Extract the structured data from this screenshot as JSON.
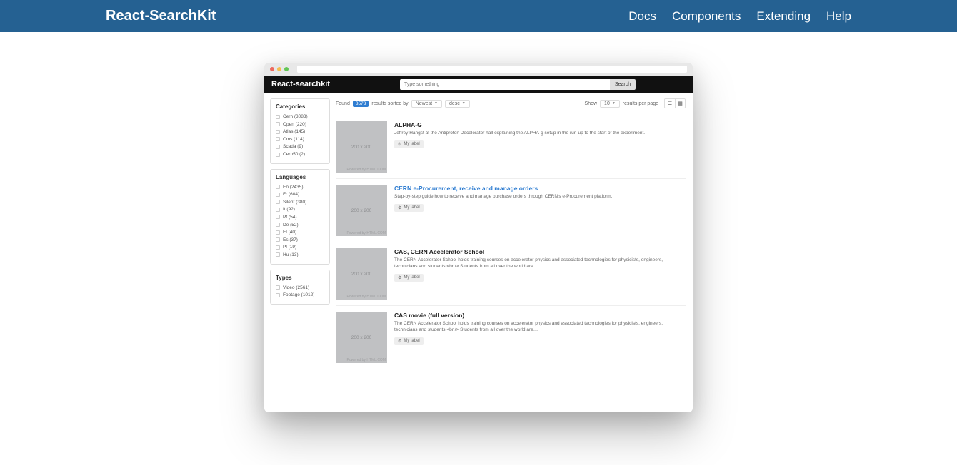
{
  "topbar": {
    "brand": "React-SearchKit",
    "nav": [
      "Docs",
      "Components",
      "Extending",
      "Help"
    ]
  },
  "app": {
    "title": "React-searchkit",
    "search_placeholder": "Type something",
    "search_button": "Search"
  },
  "controls": {
    "found_label": "Found",
    "count": "3573",
    "sorted_label": "results sorted by",
    "sort_field": "Newest",
    "sort_dir": "desc",
    "show_label": "Show",
    "page_size": "10",
    "per_page_label": "results per page"
  },
  "facets": [
    {
      "title": "Categories",
      "items": [
        "Cern (3083)",
        "Open (220)",
        "Atlas (145)",
        "Cms (114)",
        "Scada (9)",
        "Cern50 (2)"
      ]
    },
    {
      "title": "Languages",
      "items": [
        "En (2435)",
        "Fr (604)",
        "Silent (380)",
        "It (92)",
        "Pt (54)",
        "De (52)",
        "El (40)",
        "Es (37)",
        "Pl (19)",
        "Hu (13)"
      ]
    },
    {
      "title": "Types",
      "items": [
        "Video (2561)",
        "Footage (1012)"
      ]
    }
  ],
  "thumb_text": "200 x 200",
  "thumb_wm": "Powered by HTML.COM",
  "label_text": "My label",
  "results": [
    {
      "title": "ALPHA-G",
      "link": false,
      "desc": "Jeffrey Hangst at the Antiproton Decelerator hall explaining the ALPHA-g setup in the run-up to the start of the experiment."
    },
    {
      "title": "CERN e-Procurement, receive and manage orders",
      "link": true,
      "desc": "Step-by-step guide how to receive and manage purchase orders through CERN's e-Procurement platform."
    },
    {
      "title": "CAS, CERN Accelerator School",
      "link": false,
      "desc": "The CERN Accelerator School holds training courses on accelerator physics and associated technologies for physicists, engineers, technicians and students.<br /> Students from all over the world are…"
    },
    {
      "title": "CAS movie (full version)",
      "link": false,
      "desc": "The CERN Accelerator School holds training courses on accelerator physics and associated technologies for physicists, engineers, technicians and students.<br /> Students from all over the world are…"
    }
  ]
}
